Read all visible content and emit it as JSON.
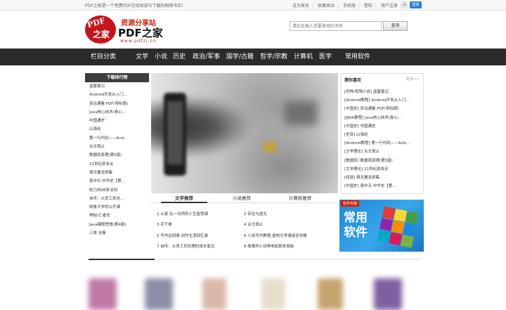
{
  "topbar": {
    "tagline": "PDF之家是一个免费PDF在线阅读与下载的网络书店!",
    "links": [
      "设为首页",
      "收藏本站",
      "手机版",
      "登陆",
      "用户注册"
    ],
    "login_label": "登录"
  },
  "header": {
    "logo_badge_top": "PDF",
    "logo_badge_bottom": "之家",
    "slogan": "资源分享站",
    "brand": "PDF之家",
    "url": "www.pdfzj.cn",
    "search_placeholder": "请在此输入您要查找的书名",
    "search_button": "查询"
  },
  "nav": {
    "category": "栏目分类",
    "items": [
      "文学",
      "小说",
      "历史",
      "政治/军事",
      "国学/古籍",
      "哲学/宗教",
      "计算机",
      "医学",
      "常用软件"
    ]
  },
  "download_rank": {
    "title": "下载排行榜",
    "items": [
      "盗墓笔记",
      "Android开发从入门...",
      "资治通鉴 PDF(带标题)",
      "Java核心技术(卷1)...",
      "中国通史",
      "山海经",
      "第一行代码——And...",
      "古文观止",
      "数据库原理(第5版)",
      "21世纪资本论",
      "倚天屠龙续集",
      "易中天·中华史【第...",
      "权力的48条法则",
      "自传：从员工到总...",
      "耶鲁大学的公开课",
      "啊帖!仁者言",
      "Java编程思想(第4版)",
      "三体·全集"
    ]
  },
  "tabs": [
    "文学推荐",
    "小说推荐",
    "计算机推荐"
  ],
  "tab_items": [
    "1 从容·弘一法师的人生智慧课",
    "2 存在与虚无",
    "3 花千骨",
    "4 古文观止",
    "5 写作这回事:创作生涯回忆录",
    "6 小说写作教程:虚构文学速成全攻略",
    "7 自传：从员工到总理的成长笔记",
    "8 故事杯2:经典电影剧本探秘"
  ],
  "guess": {
    "title": "猜你喜欢",
    "more": "更多>>",
    "items": [
      "[恐怖/惊悚小说] 盗墓笔记",
      "[Android教程] Android开发从入门...",
      "[中国史] 资治通鉴 PDF(带标题)",
      "[JAVA教程] Java核心技术(卷1)...",
      "[中国史] 中国通史",
      "[史部] 山海经",
      "[Android教程] 第一行代码——And...",
      "[文学理论] 古文观止",
      "[数据库] 数据库原理(第5版)",
      "[文学理论] 21世纪资本论",
      "[经部] 倚天屠龙续集",
      "[中国史] 易中天·中华史【第..."
    ]
  },
  "ad": {
    "tag": "软件专题",
    "text": "常用软件"
  }
}
